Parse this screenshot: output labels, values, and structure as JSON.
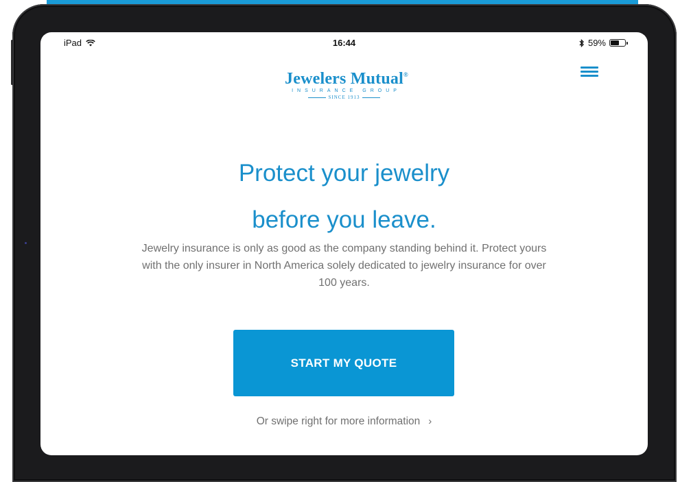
{
  "status_bar": {
    "device": "iPad",
    "time": "16:44",
    "battery": "59%",
    "battery_level": 0.59
  },
  "logo": {
    "name": "Jewelers Mutual",
    "registered": "®",
    "subtitle": "INSURANCE GROUP",
    "since": "SINCE 1913"
  },
  "menu": {
    "icon": "hamburger-menu-icon"
  },
  "hero": {
    "line1": "Protect your jewelry",
    "line2": "before you leave.",
    "body": "Jewelry insurance is only as good as the company standing behind it. Protect yours with the only insurer in North America solely dedicated to jewelry insurance for over 100 years."
  },
  "cta": {
    "label": "START MY QUOTE"
  },
  "swipe": {
    "label": "Or swipe right for more information",
    "icon": "chevron-right-icon"
  },
  "colors": {
    "brand_blue": "#1a8fcb",
    "button_blue": "#0a96d4",
    "body_text": "#707070"
  }
}
